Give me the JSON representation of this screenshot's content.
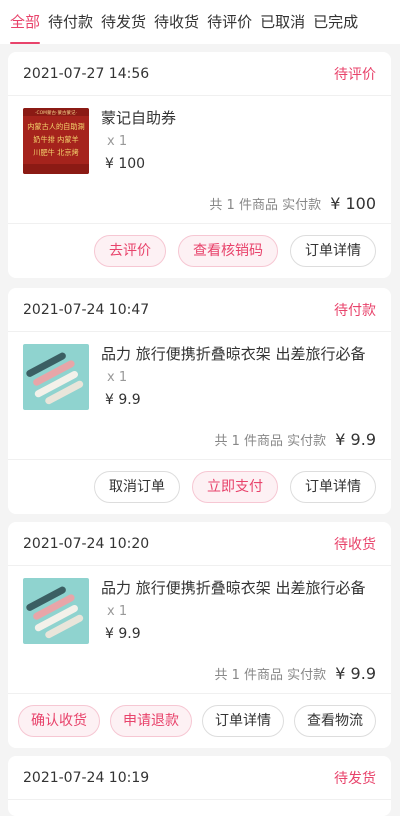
{
  "tabs": [
    {
      "label": "全部",
      "active": true
    },
    {
      "label": "待付款",
      "active": false
    },
    {
      "label": "待发货",
      "active": false
    },
    {
      "label": "待收货",
      "active": false
    },
    {
      "label": "待评价",
      "active": false
    },
    {
      "label": "已取消",
      "active": false
    },
    {
      "label": "已完成",
      "active": false
    }
  ],
  "colors": {
    "accent": "#e8436b",
    "background": "#f4f4f4"
  },
  "orders": [
    {
      "date": "2021-07-27 14:56",
      "status": "待评价",
      "goods": {
        "name": "蒙记自助券",
        "qty": "x 1",
        "price": "¥ 100",
        "thumb_icon": "coupon-thumbnail",
        "thumb_text": [
          "·COM蒙古·蒙古蒙记·",
          "内蒙古人的自助涮",
          "奶牛排 内蒙羊",
          "川肥牛 北京烤"
        ]
      },
      "summary_label": "共 1 件商品 实付款",
      "summary_total": "¥ 100",
      "buttons": [
        "去评价",
        "查看核销码",
        "订单详情"
      ]
    },
    {
      "date": "2021-07-24 10:47",
      "status": "待付款",
      "goods": {
        "name": "品力 旅行便携折叠晾衣架 出差旅行必备",
        "qty": "x 1",
        "price": "¥ 9.9",
        "thumb_icon": "hanger-thumbnail"
      },
      "summary_label": "共 1 件商品 实付款",
      "summary_total": "¥ 9.9",
      "buttons": [
        "取消订单",
        "立即支付",
        "订单详情"
      ]
    },
    {
      "date": "2021-07-24 10:20",
      "status": "待收货",
      "goods": {
        "name": "品力 旅行便携折叠晾衣架 出差旅行必备",
        "qty": "x 1",
        "price": "¥ 9.9",
        "thumb_icon": "hanger-thumbnail"
      },
      "summary_label": "共 1 件商品 实付款",
      "summary_total": "¥ 9.9",
      "buttons": [
        "确认收货",
        "申请退款",
        "订单详情",
        "查看物流"
      ]
    },
    {
      "date": "2021-07-24 10:19",
      "status": "待发货"
    }
  ]
}
